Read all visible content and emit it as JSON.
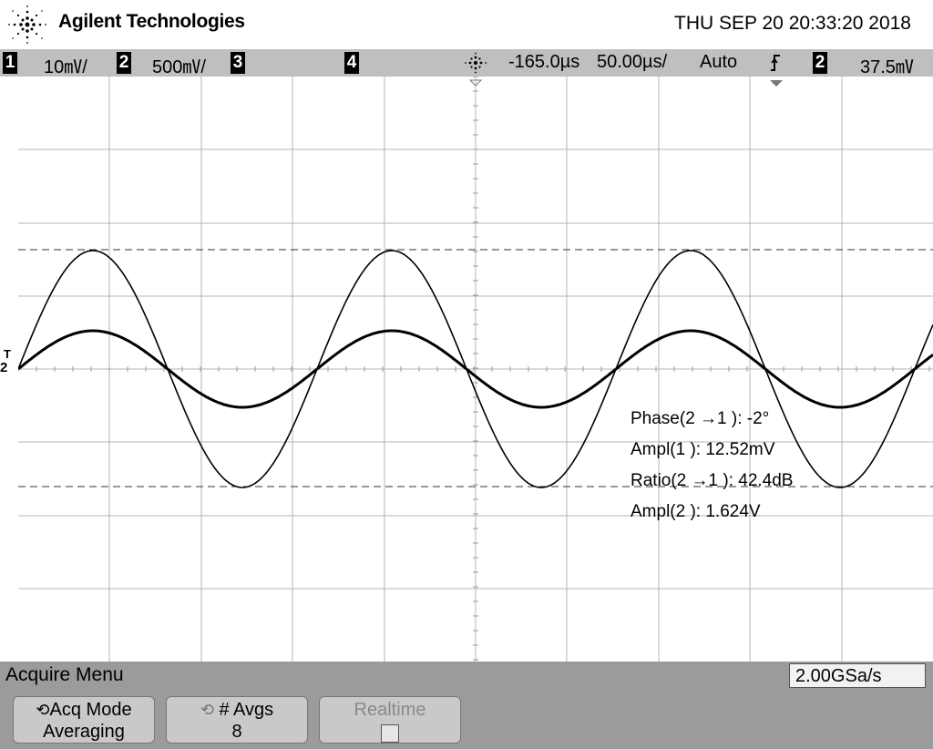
{
  "header": {
    "brand": "Agilent Technologies",
    "datetime": "THU SEP 20 20:33:20 2018"
  },
  "status_bar": {
    "ch1_num": "1",
    "ch1_scale": "10㎷/",
    "ch2_num": "2",
    "ch2_scale": "500㎷/",
    "ch3_num": "3",
    "ch4_num": "4",
    "time_delay": "-165.0µs",
    "time_scale": "50.00µs/",
    "trigger_mode": "Auto",
    "trigger_slope_icon": "rising-edge-icon",
    "trigger_source": "2",
    "trigger_level": "37.5㎷"
  },
  "screen": {
    "ground_marker": "T",
    "ch_marker": "2"
  },
  "measurements": {
    "phase": "Phase(2 →1 ): -2°",
    "ampl1": "Ampl(1 ): 12.52mV",
    "ratio": "Ratio(2 →1 ): 42.4dB",
    "ampl2": "Ampl(2 ): 1.624V"
  },
  "menu": {
    "title": "Acquire Menu",
    "sample_rate": "2.00GSa/s",
    "softkeys": [
      {
        "label": "Acq Mode",
        "value": "Averaging"
      },
      {
        "label": "# Avgs",
        "value": "8"
      },
      {
        "label": "Realtime",
        "value": ""
      }
    ]
  },
  "colors": {
    "background": "#ffffff",
    "status_bar": "#bfbfbf",
    "menu": "#9b9b9b",
    "trace": "#000000"
  }
}
